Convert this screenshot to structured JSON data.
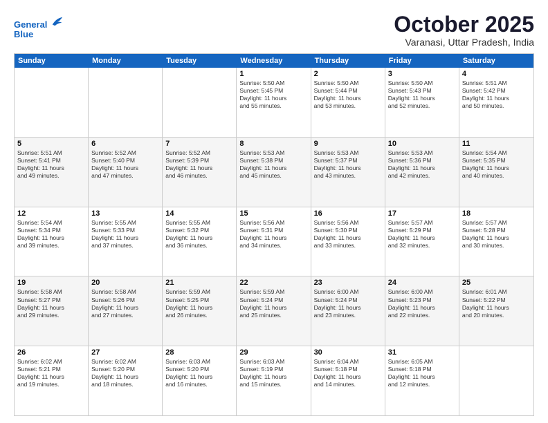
{
  "header": {
    "logo_line1": "General",
    "logo_line2": "Blue",
    "month_title": "October 2025",
    "location": "Varanasi, Uttar Pradesh, India"
  },
  "weekdays": [
    "Sunday",
    "Monday",
    "Tuesday",
    "Wednesday",
    "Thursday",
    "Friday",
    "Saturday"
  ],
  "rows": [
    [
      {
        "day": "",
        "info": ""
      },
      {
        "day": "",
        "info": ""
      },
      {
        "day": "",
        "info": ""
      },
      {
        "day": "1",
        "info": "Sunrise: 5:50 AM\nSunset: 5:45 PM\nDaylight: 11 hours\nand 55 minutes."
      },
      {
        "day": "2",
        "info": "Sunrise: 5:50 AM\nSunset: 5:44 PM\nDaylight: 11 hours\nand 53 minutes."
      },
      {
        "day": "3",
        "info": "Sunrise: 5:50 AM\nSunset: 5:43 PM\nDaylight: 11 hours\nand 52 minutes."
      },
      {
        "day": "4",
        "info": "Sunrise: 5:51 AM\nSunset: 5:42 PM\nDaylight: 11 hours\nand 50 minutes."
      }
    ],
    [
      {
        "day": "5",
        "info": "Sunrise: 5:51 AM\nSunset: 5:41 PM\nDaylight: 11 hours\nand 49 minutes."
      },
      {
        "day": "6",
        "info": "Sunrise: 5:52 AM\nSunset: 5:40 PM\nDaylight: 11 hours\nand 47 minutes."
      },
      {
        "day": "7",
        "info": "Sunrise: 5:52 AM\nSunset: 5:39 PM\nDaylight: 11 hours\nand 46 minutes."
      },
      {
        "day": "8",
        "info": "Sunrise: 5:53 AM\nSunset: 5:38 PM\nDaylight: 11 hours\nand 45 minutes."
      },
      {
        "day": "9",
        "info": "Sunrise: 5:53 AM\nSunset: 5:37 PM\nDaylight: 11 hours\nand 43 minutes."
      },
      {
        "day": "10",
        "info": "Sunrise: 5:53 AM\nSunset: 5:36 PM\nDaylight: 11 hours\nand 42 minutes."
      },
      {
        "day": "11",
        "info": "Sunrise: 5:54 AM\nSunset: 5:35 PM\nDaylight: 11 hours\nand 40 minutes."
      }
    ],
    [
      {
        "day": "12",
        "info": "Sunrise: 5:54 AM\nSunset: 5:34 PM\nDaylight: 11 hours\nand 39 minutes."
      },
      {
        "day": "13",
        "info": "Sunrise: 5:55 AM\nSunset: 5:33 PM\nDaylight: 11 hours\nand 37 minutes."
      },
      {
        "day": "14",
        "info": "Sunrise: 5:55 AM\nSunset: 5:32 PM\nDaylight: 11 hours\nand 36 minutes."
      },
      {
        "day": "15",
        "info": "Sunrise: 5:56 AM\nSunset: 5:31 PM\nDaylight: 11 hours\nand 34 minutes."
      },
      {
        "day": "16",
        "info": "Sunrise: 5:56 AM\nSunset: 5:30 PM\nDaylight: 11 hours\nand 33 minutes."
      },
      {
        "day": "17",
        "info": "Sunrise: 5:57 AM\nSunset: 5:29 PM\nDaylight: 11 hours\nand 32 minutes."
      },
      {
        "day": "18",
        "info": "Sunrise: 5:57 AM\nSunset: 5:28 PM\nDaylight: 11 hours\nand 30 minutes."
      }
    ],
    [
      {
        "day": "19",
        "info": "Sunrise: 5:58 AM\nSunset: 5:27 PM\nDaylight: 11 hours\nand 29 minutes."
      },
      {
        "day": "20",
        "info": "Sunrise: 5:58 AM\nSunset: 5:26 PM\nDaylight: 11 hours\nand 27 minutes."
      },
      {
        "day": "21",
        "info": "Sunrise: 5:59 AM\nSunset: 5:25 PM\nDaylight: 11 hours\nand 26 minutes."
      },
      {
        "day": "22",
        "info": "Sunrise: 5:59 AM\nSunset: 5:24 PM\nDaylight: 11 hours\nand 25 minutes."
      },
      {
        "day": "23",
        "info": "Sunrise: 6:00 AM\nSunset: 5:24 PM\nDaylight: 11 hours\nand 23 minutes."
      },
      {
        "day": "24",
        "info": "Sunrise: 6:00 AM\nSunset: 5:23 PM\nDaylight: 11 hours\nand 22 minutes."
      },
      {
        "day": "25",
        "info": "Sunrise: 6:01 AM\nSunset: 5:22 PM\nDaylight: 11 hours\nand 20 minutes."
      }
    ],
    [
      {
        "day": "26",
        "info": "Sunrise: 6:02 AM\nSunset: 5:21 PM\nDaylight: 11 hours\nand 19 minutes."
      },
      {
        "day": "27",
        "info": "Sunrise: 6:02 AM\nSunset: 5:20 PM\nDaylight: 11 hours\nand 18 minutes."
      },
      {
        "day": "28",
        "info": "Sunrise: 6:03 AM\nSunset: 5:20 PM\nDaylight: 11 hours\nand 16 minutes."
      },
      {
        "day": "29",
        "info": "Sunrise: 6:03 AM\nSunset: 5:19 PM\nDaylight: 11 hours\nand 15 minutes."
      },
      {
        "day": "30",
        "info": "Sunrise: 6:04 AM\nSunset: 5:18 PM\nDaylight: 11 hours\nand 14 minutes."
      },
      {
        "day": "31",
        "info": "Sunrise: 6:05 AM\nSunset: 5:18 PM\nDaylight: 11 hours\nand 12 minutes."
      },
      {
        "day": "",
        "info": ""
      }
    ]
  ]
}
